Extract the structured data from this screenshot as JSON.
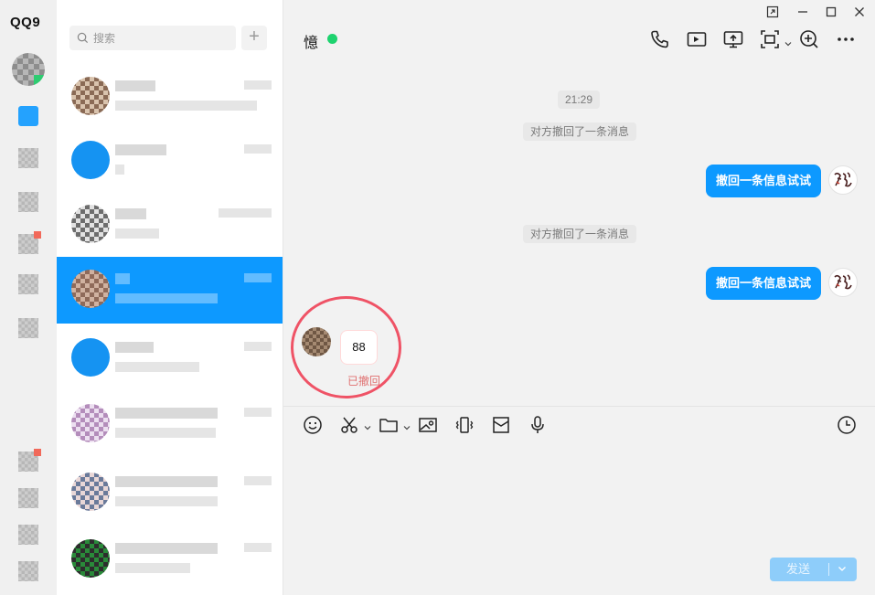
{
  "app": {
    "brand": "QQ9"
  },
  "search": {
    "placeholder": "搜索"
  },
  "chat": {
    "title": "憶",
    "status_color": "#1ed36f",
    "timestamp": "21:29",
    "messages": [
      {
        "type": "system",
        "text": "对方撤回了一条消息"
      },
      {
        "type": "outgoing",
        "text": "撤回一条信息试试"
      },
      {
        "type": "system",
        "text": "对方撤回了一条消息"
      },
      {
        "type": "outgoing",
        "text": "撤回一条信息试试"
      },
      {
        "type": "incoming",
        "text": "88",
        "note": "已撤回"
      }
    ]
  },
  "header_icons": [
    "phone-icon",
    "video-icon",
    "screen-share-icon",
    "screenshot-icon",
    "add-member-icon",
    "more-icon"
  ],
  "composer_tools": [
    "emoji-icon",
    "scissors-icon",
    "folder-icon",
    "image-icon",
    "shake-icon",
    "red-packet-icon",
    "microphone-icon",
    "history-icon"
  ],
  "composer": {
    "send_label": "发送"
  },
  "colors": {
    "accent": "#0d99ff",
    "highlight": "#ef5366",
    "recalled_text": "#e07070"
  }
}
